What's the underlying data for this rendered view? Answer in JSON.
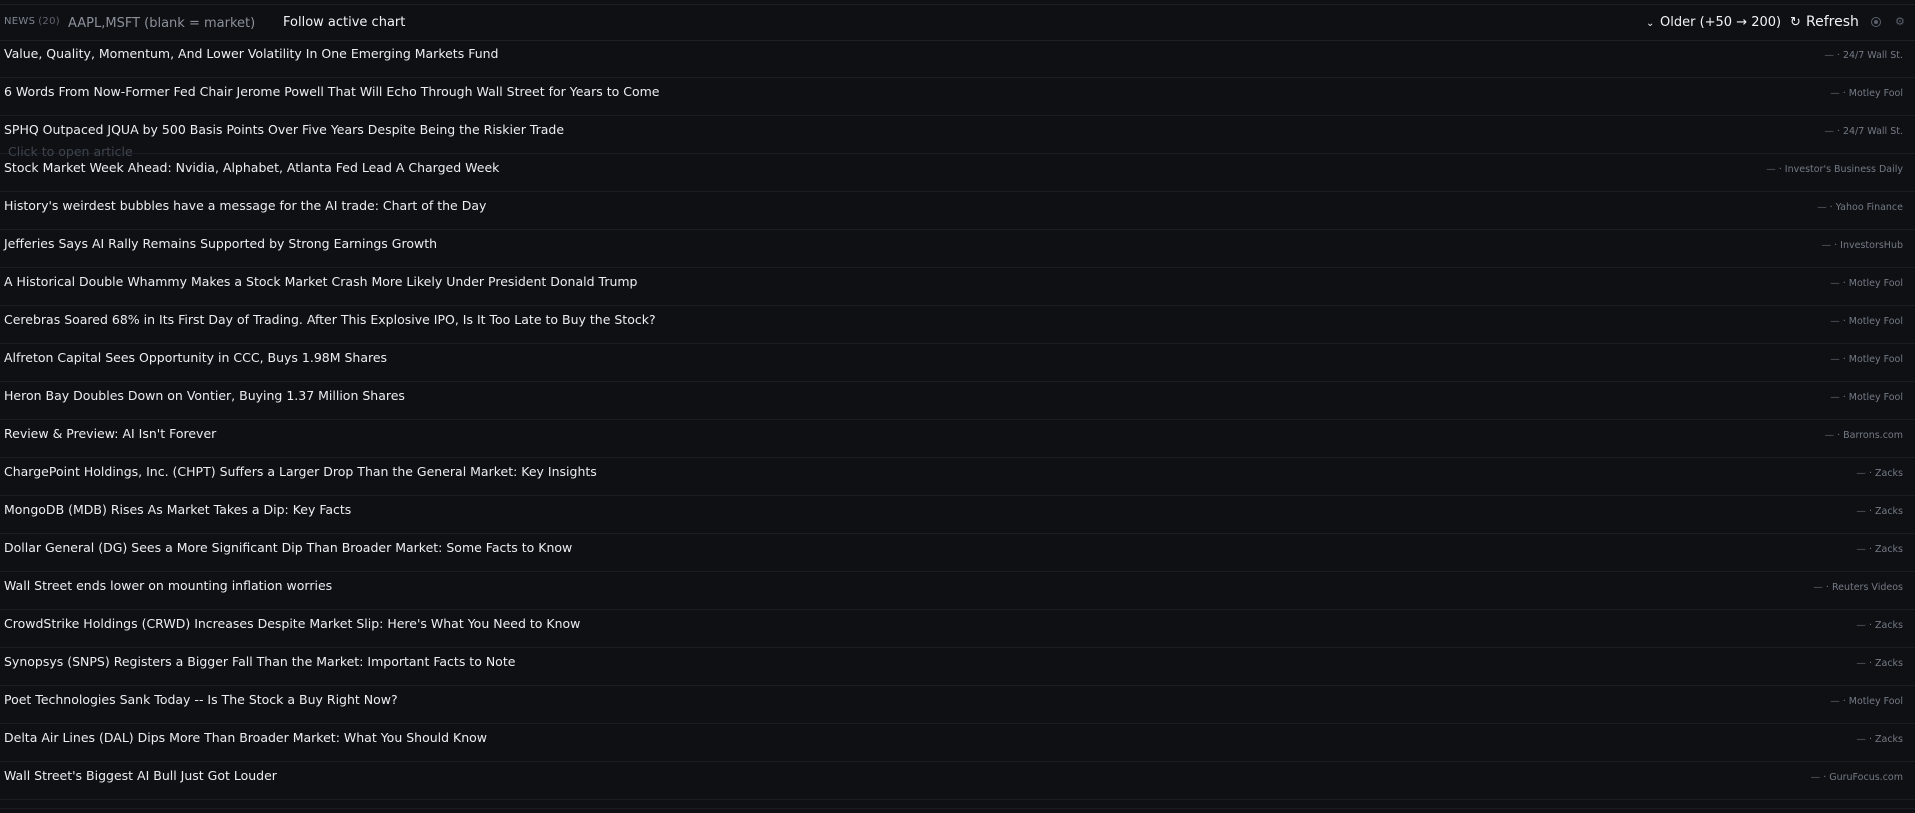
{
  "header": {
    "title": "NEWS",
    "count": "(20)",
    "ticker_placeholder": "AAPL,MSFT (blank = market)",
    "follow_label": "Follow active chart",
    "older_label": "Older (+50 → 200)",
    "refresh_label": "Refresh"
  },
  "tooltip": "Click to open article",
  "articles": [
    {
      "headline": "Value, Quality, Momentum, And Lower Volatility In One Emerging Markets Fund",
      "time": "—",
      "source": "24/7 Wall St."
    },
    {
      "headline": "6 Words From Now-Former Fed Chair Jerome Powell That Will Echo Through Wall Street for Years to Come",
      "time": "—",
      "source": "Motley Fool"
    },
    {
      "headline": "SPHQ Outpaced JQUA by 500 Basis Points Over Five Years Despite Being the Riskier Trade",
      "time": "—",
      "source": "24/7 Wall St."
    },
    {
      "headline": "Stock Market Week Ahead: Nvidia, Alphabet, Atlanta Fed Lead A Charged Week",
      "time": "—",
      "source": "Investor's Business Daily"
    },
    {
      "headline": "History's weirdest bubbles have a message for the AI trade: Chart of the Day",
      "time": "—",
      "source": "Yahoo Finance"
    },
    {
      "headline": "Jefferies Says AI Rally Remains Supported by Strong Earnings Growth",
      "time": "—",
      "source": "InvestorsHub"
    },
    {
      "headline": "A Historical Double Whammy Makes a Stock Market Crash More Likely Under President Donald Trump",
      "time": "—",
      "source": "Motley Fool"
    },
    {
      "headline": "Cerebras Soared 68% in Its First Day of Trading. After This Explosive IPO, Is It Too Late to Buy the Stock?",
      "time": "—",
      "source": "Motley Fool"
    },
    {
      "headline": "Alfreton Capital Sees Opportunity in CCC, Buys 1.98M Shares",
      "time": "—",
      "source": "Motley Fool"
    },
    {
      "headline": "Heron Bay Doubles Down on Vontier, Buying 1.37 Million Shares",
      "time": "—",
      "source": "Motley Fool"
    },
    {
      "headline": "Review & Preview: AI Isn't Forever",
      "time": "—",
      "source": "Barrons.com"
    },
    {
      "headline": "ChargePoint Holdings, Inc. (CHPT) Suffers a Larger Drop Than the General Market: Key Insights",
      "time": "—",
      "source": "Zacks"
    },
    {
      "headline": "MongoDB (MDB) Rises As Market Takes a Dip: Key Facts",
      "time": "—",
      "source": "Zacks"
    },
    {
      "headline": "Dollar General (DG) Sees a More Significant Dip Than Broader Market: Some Facts to Know",
      "time": "—",
      "source": "Zacks"
    },
    {
      "headline": "Wall Street ends lower on mounting inflation worries",
      "time": "—",
      "source": "Reuters Videos"
    },
    {
      "headline": "CrowdStrike Holdings (CRWD) Increases Despite Market Slip: Here's What You Need to Know",
      "time": "—",
      "source": "Zacks"
    },
    {
      "headline": "Synopsys (SNPS) Registers a Bigger Fall Than the Market: Important Facts to Note",
      "time": "—",
      "source": "Zacks"
    },
    {
      "headline": "Poet Technologies Sank Today -- Is The Stock a Buy Right Now?",
      "time": "—",
      "source": "Motley Fool"
    },
    {
      "headline": "Delta Air Lines (DAL) Dips More Than Broader Market: What You Should Know",
      "time": "—",
      "source": "Zacks"
    },
    {
      "headline": "Wall Street's Biggest AI Bull Just Got Louder",
      "time": "—",
      "source": "GuruFocus.com"
    }
  ]
}
